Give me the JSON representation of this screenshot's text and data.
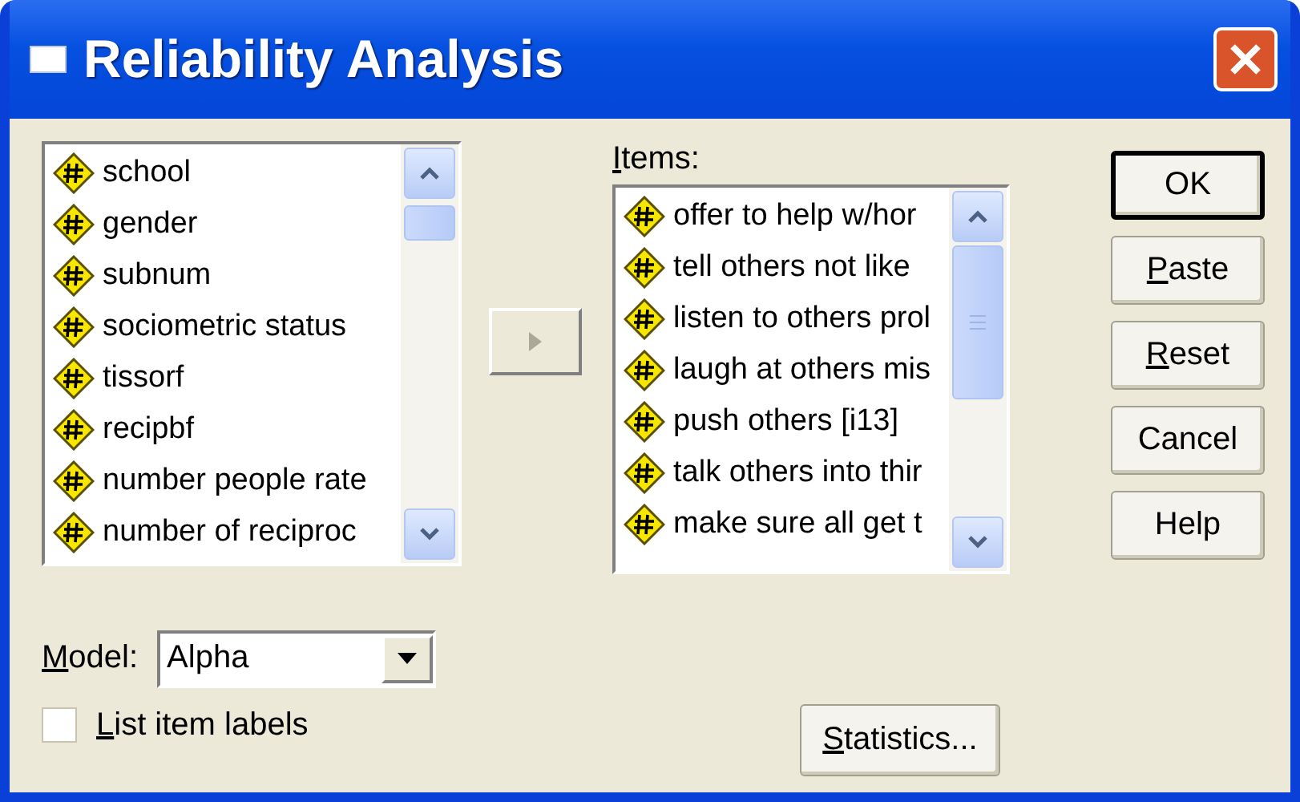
{
  "window": {
    "title": "Reliability Analysis"
  },
  "variables": [
    {
      "label": "school"
    },
    {
      "label": "gender"
    },
    {
      "label": "subnum"
    },
    {
      "label": "sociometric status"
    },
    {
      "label": "tissorf"
    },
    {
      "label": "recipbf"
    },
    {
      "label": "number people rate"
    },
    {
      "label": "number of reciproc"
    }
  ],
  "move_button": {
    "disabled": true
  },
  "items_label": {
    "accel": "I",
    "rest": "tems:"
  },
  "items": [
    {
      "label": "offer to help w/hor"
    },
    {
      "label": "tell others not like"
    },
    {
      "label": "listen to others prol"
    },
    {
      "label": "laugh at others mis"
    },
    {
      "label": "push others [i13]"
    },
    {
      "label": "talk others into thir"
    },
    {
      "label": "make sure all get t"
    }
  ],
  "buttons": [
    {
      "rest": "OK",
      "default": true
    },
    {
      "accel": "P",
      "rest": "aste",
      "default": false
    },
    {
      "accel": "R",
      "rest": "eset",
      "default": false
    },
    {
      "rest": "Cancel",
      "default": false
    },
    {
      "rest": "Help",
      "default": false
    }
  ],
  "model": {
    "label": {
      "accel": "M",
      "rest": "odel:"
    },
    "value": "Alpha"
  },
  "list_item_labels": {
    "label": {
      "accel": "L",
      "rest": "ist item labels"
    },
    "checked": false
  },
  "statistics_button": {
    "accel": "S",
    "rest": "tatistics..."
  }
}
